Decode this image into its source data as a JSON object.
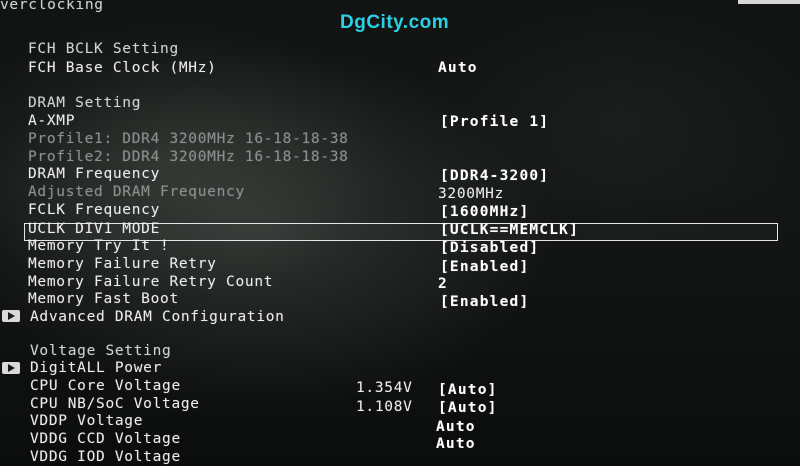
{
  "header": {
    "title": "verclocking"
  },
  "watermark": "DgCity.com",
  "fch": {
    "section": "FCH BCLK Setting",
    "base_clock_label": "FCH Base Clock (MHz)",
    "base_clock_value": "Auto"
  },
  "dram": {
    "section": "DRAM Setting",
    "axmp_label": "A-XMP",
    "axmp_value": "[Profile 1]",
    "profile1": "Profile1: DDR4 3200MHz 16-18-18-38",
    "profile2": "Profile2: DDR4 3200MHz 16-18-18-38",
    "freq_label": "DRAM Frequency",
    "freq_value": "[DDR4-3200]",
    "adj_freq_label": "Adjusted DRAM Frequency",
    "adj_freq_value": "3200MHz",
    "fclk_label": "FCLK Frequency",
    "fclk_value": "[1600MHz]",
    "uclk_label": "UCLK DIV1 MODE",
    "uclk_value": "[UCLK==MEMCLK]",
    "try_it_label": "Memory Try It !",
    "try_it_value": "[Disabled]",
    "fail_retry_label": "Memory Failure Retry",
    "fail_retry_value": "[Enabled]",
    "fail_retry_count_label": "Memory Failure Retry Count",
    "fail_retry_count_value": "2",
    "fast_boot_label": "Memory Fast Boot",
    "fast_boot_value": "[Enabled]",
    "advanced_label": "Advanced DRAM Configuration"
  },
  "voltage": {
    "section": "Voltage Setting",
    "digitall_label": "DigitALL Power",
    "cpu_core_label": "CPU Core Voltage",
    "cpu_core_current": "1.354V",
    "cpu_core_value": "[Auto]",
    "cpu_nb_label": "CPU NB/SoC Voltage",
    "cpu_nb_current": "1.108V",
    "cpu_nb_value": "[Auto]",
    "vddp_label": "VDDP Voltage",
    "vddp_value": "Auto",
    "vddg_ccd_label": "VDDG CCD Voltage",
    "vddg_ccd_value": "Auto",
    "vddg_iod_label": "VDDG IOD Voltage"
  },
  "colors": {
    "watermark": "#2ad0e6",
    "text": "#ececec",
    "dim": "#8a8f8c",
    "background": "#0b0d0c"
  }
}
